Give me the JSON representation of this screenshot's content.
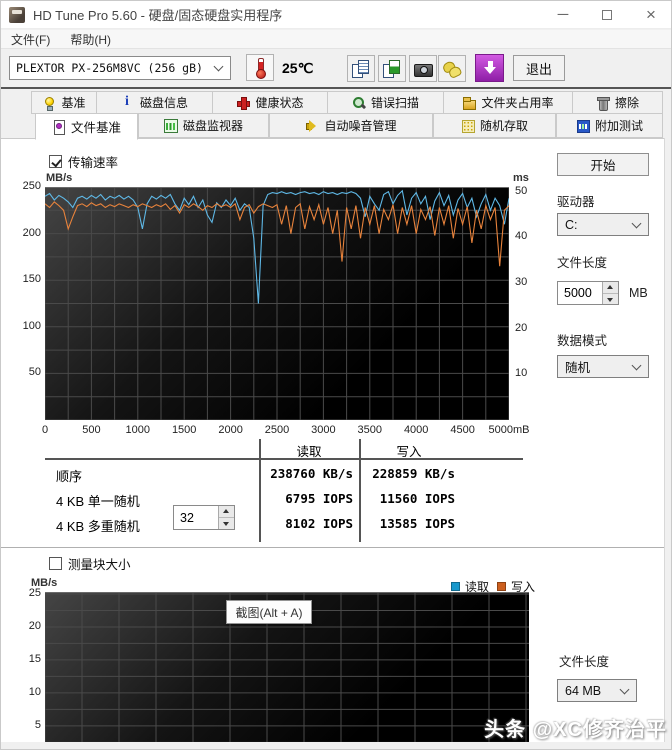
{
  "window": {
    "title": "HD Tune Pro 5.60 - 硬盘/固态硬盘实用程序"
  },
  "menu": {
    "file": "文件(F)",
    "help": "帮助(H)"
  },
  "toolbar": {
    "drive": "PLEXTOR PX-256M8VC (256 gB)",
    "temperature": "25℃",
    "exit_label": "退出",
    "icons": [
      "copy-text-icon",
      "copy-image-icon",
      "camera-icon",
      "donate-hands-icon",
      "update-download-icon"
    ]
  },
  "tabs": {
    "row1": [
      "基准",
      "磁盘信息",
      "健康状态",
      "错误扫描",
      "文件夹占用率",
      "擦除"
    ],
    "row2": [
      "文件基准",
      "磁盘监视器",
      "自动噪音管理",
      "随机存取",
      "附加测试"
    ],
    "active": "文件基准"
  },
  "file_benchmark": {
    "transfer_checkbox": "传输速率",
    "start_button": "开始",
    "drive_label": "驱动器",
    "drive_value": "C:",
    "file_length_label": "文件长度",
    "file_length_value": "5000",
    "file_length_unit": "MB",
    "data_mode_label": "数据模式",
    "data_mode_value": "随机",
    "results": {
      "col_read": "读取",
      "col_write": "写入",
      "rows": [
        {
          "label": "顺序",
          "read": "238760 KB/s",
          "write": "228859 KB/s"
        },
        {
          "label": "4 KB 单一随机",
          "read": "6795 IOPS",
          "write": "11560 IOPS"
        },
        {
          "label": "4 KB 多重随机",
          "queue": "32",
          "read": "8102 IOPS",
          "write": "13585 IOPS"
        }
      ]
    },
    "block_checkbox": "测量块大小",
    "legend": [
      {
        "label": "读取",
        "color": "#1898cc"
      },
      {
        "label": "写入",
        "color": "#cc5f1e"
      }
    ],
    "tooltip": "截图(Alt + A)",
    "file_length2_label": "文件长度",
    "file_length2_value": "64 MB"
  },
  "watermark": "头条 @XC修齐治平",
  "chart_data": [
    {
      "type": "line",
      "title": "传输速率",
      "ylabel": "MB/s",
      "y2label": "ms",
      "xlabel": "mB",
      "xlim": [
        0,
        5000
      ],
      "ylim": [
        0,
        250
      ],
      "y2lim": [
        0,
        51
      ],
      "grid_x": 250,
      "grid_y": 25,
      "x_step": 50,
      "x_ticks": [
        "0",
        "500",
        "1000",
        "1500",
        "2000",
        "2500",
        "3000",
        "3500",
        "4000",
        "4500",
        "5000mB"
      ],
      "y_ticks": [
        250,
        200,
        150,
        100,
        50
      ],
      "y2_ticks": [
        50,
        40,
        30,
        20,
        10
      ],
      "series": [
        {
          "name": "读取",
          "color": "#5fb8e6",
          "values": [
            240,
            243,
            236,
            241,
            238,
            234,
            228,
            238,
            240,
            237,
            241,
            238,
            242,
            236,
            240,
            238,
            241,
            237,
            240,
            236,
            228,
            205,
            232,
            240,
            237,
            241,
            238,
            242,
            232,
            225,
            238,
            231,
            240,
            228,
            236,
            220,
            212,
            233,
            228,
            236,
            230,
            238,
            225,
            232,
            228,
            195,
            125,
            230,
            242,
            244,
            243,
            245,
            243,
            244,
            242,
            244,
            245,
            243,
            244,
            242,
            245,
            243,
            244,
            242,
            244,
            243,
            245,
            243,
            238,
            218,
            240,
            232,
            225,
            242,
            245,
            232,
            241,
            246,
            220,
            238,
            244,
            232,
            240,
            215,
            235,
            244,
            230,
            241,
            220,
            236,
            243,
            228,
            238,
            218,
            232,
            242,
            225,
            238,
            230,
            210,
            238
          ]
        },
        {
          "name": "写入",
          "color": "#e8833c",
          "values": [
            232,
            228,
            234,
            230,
            225,
            205,
            218,
            230,
            232,
            229,
            233,
            230,
            232,
            228,
            231,
            229,
            232,
            230,
            228,
            231,
            229,
            232,
            230,
            228,
            231,
            229,
            232,
            226,
            230,
            222,
            231,
            228,
            232,
            229,
            225,
            230,
            228,
            232,
            229,
            231,
            228,
            232,
            215,
            228,
            231,
            222,
            229,
            232,
            230,
            228,
            231,
            210,
            230,
            200,
            228,
            232,
            205,
            229,
            215,
            231,
            210,
            228,
            200,
            225,
            170,
            228,
            205,
            230,
            195,
            228,
            210,
            230,
            200,
            226,
            215,
            231,
            200,
            228,
            210,
            230,
            200,
            226,
            215,
            229,
            198,
            228,
            210,
            230,
            195,
            227,
            210,
            229,
            190,
            225,
            205,
            230,
            215,
            228,
            165,
            225,
            230
          ]
        }
      ]
    },
    {
      "type": "line",
      "title": "测量块大小",
      "ylabel": "MB/s",
      "ylim": [
        2.4,
        25.3
      ],
      "grid_y": 2.5,
      "y_ticks": [
        25,
        20,
        15,
        10,
        5
      ],
      "series": []
    }
  ]
}
